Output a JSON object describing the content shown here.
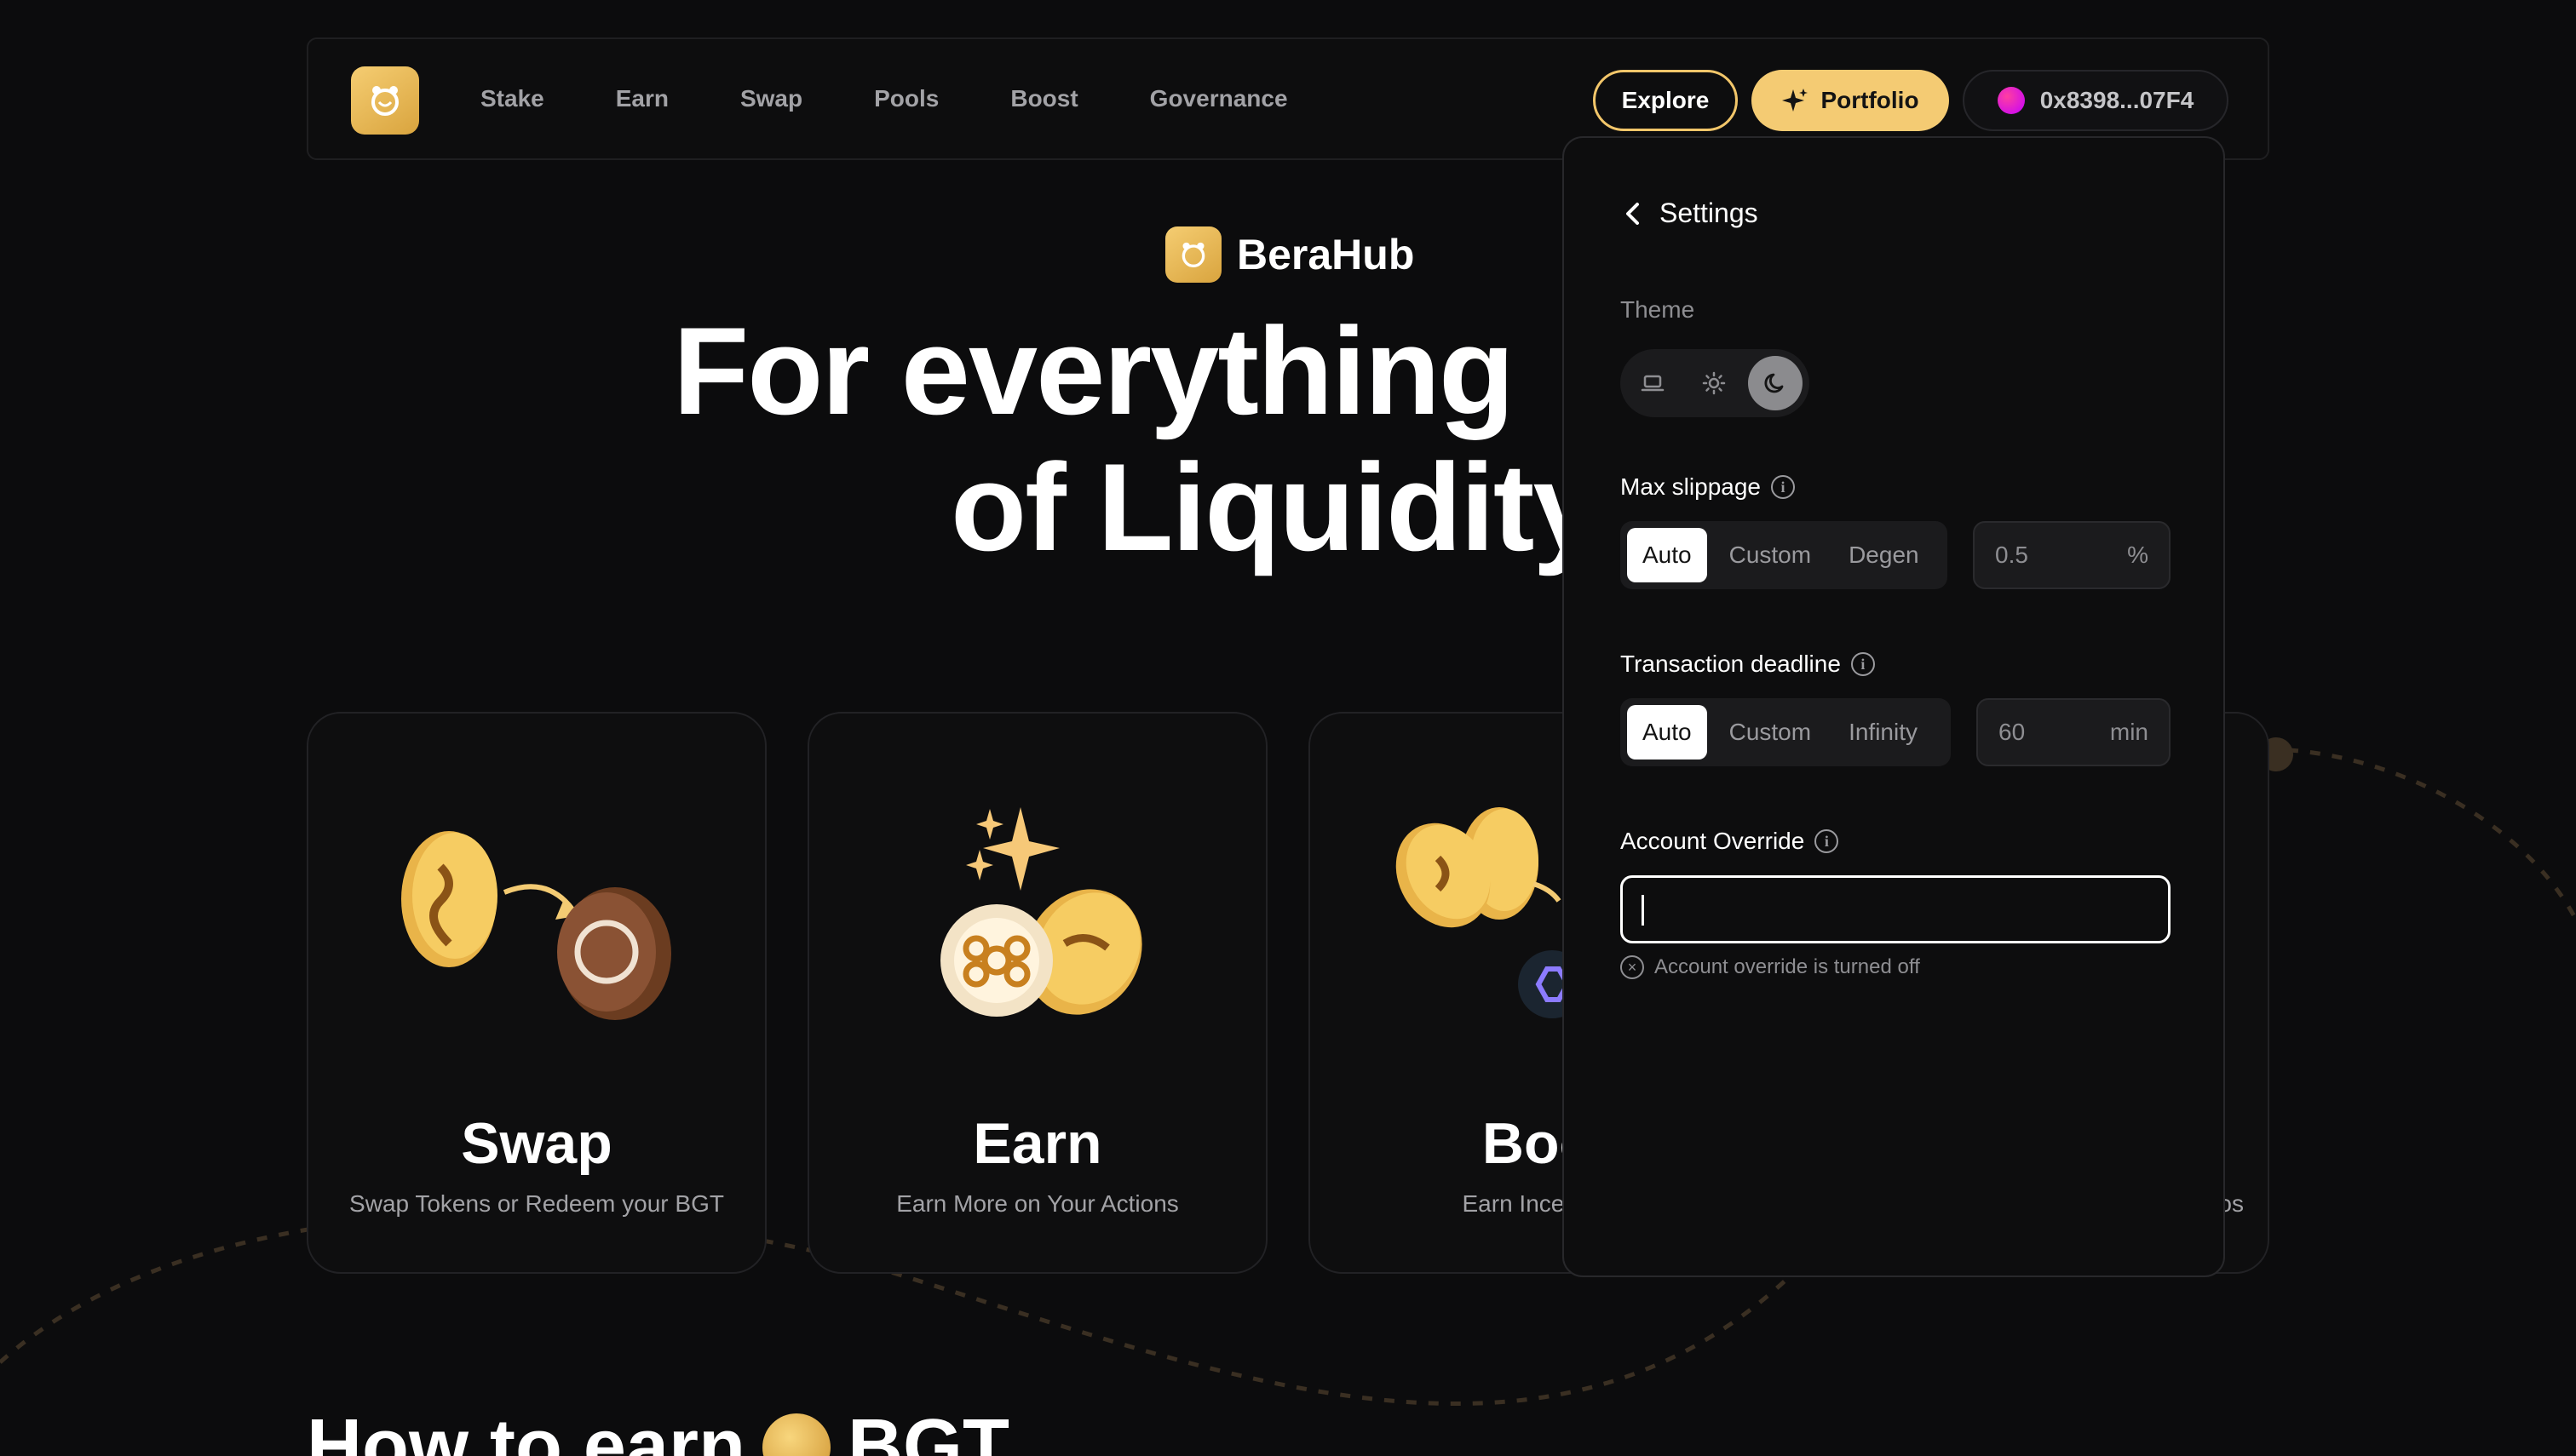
{
  "nav": {
    "links": [
      "Stake",
      "Earn",
      "Swap",
      "Pools",
      "Boost",
      "Governance"
    ],
    "explore_label": "Explore",
    "portfolio_label": "Portfolio",
    "wallet_address": "0x8398...07F4"
  },
  "hero": {
    "brand": "BeraHub",
    "line1": "For everything",
    "line2": "of Liquidity"
  },
  "cards": [
    {
      "title": "Swap",
      "subtitle": "Swap Tokens or Redeem your BGT"
    },
    {
      "title": "Earn",
      "subtitle": "Earn More on Your Actions"
    },
    {
      "title": "Boo",
      "subtitle": "Earn Incentive"
    },
    {
      "title": "",
      "subtitle": "os"
    }
  ],
  "how_to_earn": {
    "prefix": "How to earn",
    "suffix": "BGT"
  },
  "settings": {
    "back_label": "Settings",
    "theme_label": "Theme",
    "theme_selected": "dark",
    "slippage": {
      "label": "Max slippage",
      "options": [
        "Auto",
        "Custom",
        "Degen"
      ],
      "selected": "Auto",
      "value": "0.5",
      "unit": "%"
    },
    "deadline": {
      "label": "Transaction deadline",
      "options": [
        "Auto",
        "Custom",
        "Infinity"
      ],
      "selected": "Auto",
      "value": "60",
      "unit": "min"
    },
    "account_override": {
      "label": "Account Override",
      "value": "",
      "status": "Account override is turned off"
    }
  },
  "colors": {
    "background": "#0c0c0d",
    "accent": "#f4cb73",
    "muted_text": "#a2a2a6"
  }
}
